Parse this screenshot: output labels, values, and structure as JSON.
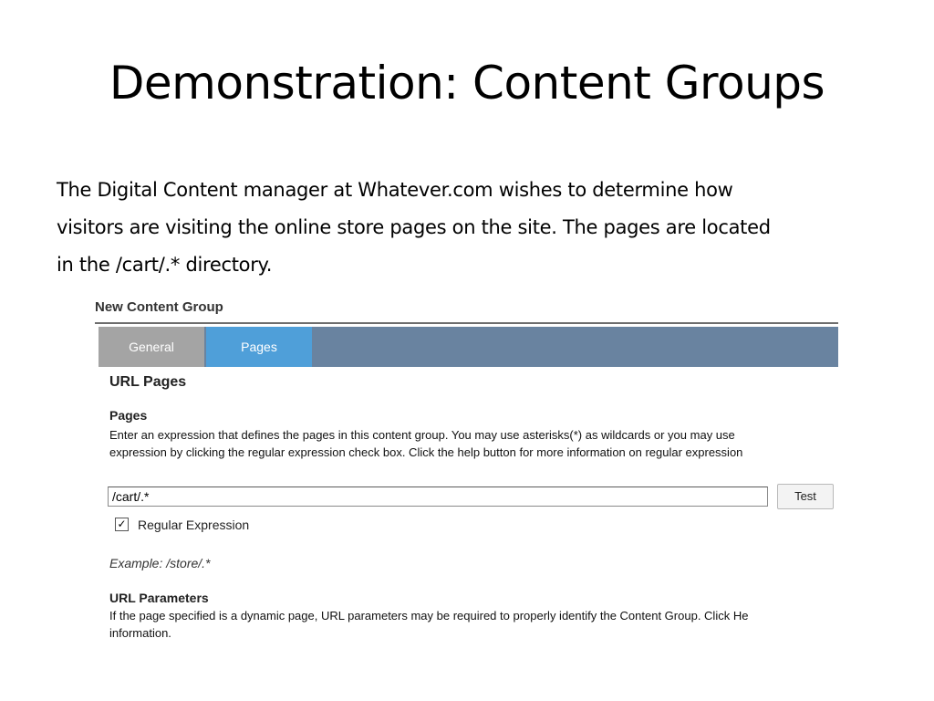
{
  "slide": {
    "title": "Demonstration: Content Groups",
    "body_lines": [
      "The Digital Content manager at Whatever.com wishes to determine how",
      "visitors are visiting the online store pages on the site.  The pages are located",
      "in the /cart/.* directory."
    ]
  },
  "panel": {
    "title": "New Content Group",
    "tabs": [
      {
        "label": "General",
        "active": false
      },
      {
        "label": "Pages",
        "active": true
      }
    ],
    "section_title": "URL Pages",
    "pages": {
      "heading": "Pages",
      "description_lines": [
        "Enter an expression that defines the pages in this content group. You may use asterisks(*) as wildcards or you may use",
        "expression by clicking the regular expression check box. Click the help button for more information on regular expression"
      ],
      "input_value": "/cart/.*",
      "test_button": "Test",
      "checkbox_label": "Regular Expression",
      "checkbox_checked": true,
      "example": "Example: /store/.*"
    },
    "url_parameters": {
      "heading": "URL Parameters",
      "description_lines": [
        "If the page specified is a dynamic page, URL parameters may be required to properly identify the Content Group. Click He",
        "information."
      ]
    }
  },
  "colors": {
    "tab_bar": "#6983a0",
    "tab_active": "#4f9fd9",
    "tab_inactive": "#a4a4a4"
  }
}
